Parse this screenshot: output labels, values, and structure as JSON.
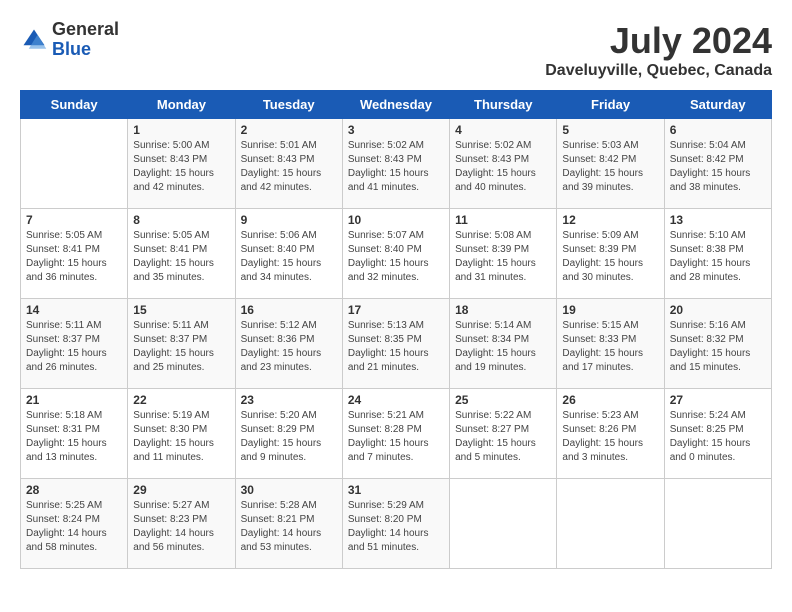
{
  "logo": {
    "general": "General",
    "blue": "Blue"
  },
  "title": {
    "month_year": "July 2024",
    "location": "Daveluyville, Quebec, Canada"
  },
  "headers": [
    "Sunday",
    "Monday",
    "Tuesday",
    "Wednesday",
    "Thursday",
    "Friday",
    "Saturday"
  ],
  "weeks": [
    [
      {
        "day": "",
        "sunrise": "",
        "sunset": "",
        "daylight": ""
      },
      {
        "day": "1",
        "sunrise": "Sunrise: 5:00 AM",
        "sunset": "Sunset: 8:43 PM",
        "daylight": "Daylight: 15 hours and 42 minutes."
      },
      {
        "day": "2",
        "sunrise": "Sunrise: 5:01 AM",
        "sunset": "Sunset: 8:43 PM",
        "daylight": "Daylight: 15 hours and 42 minutes."
      },
      {
        "day": "3",
        "sunrise": "Sunrise: 5:02 AM",
        "sunset": "Sunset: 8:43 PM",
        "daylight": "Daylight: 15 hours and 41 minutes."
      },
      {
        "day": "4",
        "sunrise": "Sunrise: 5:02 AM",
        "sunset": "Sunset: 8:43 PM",
        "daylight": "Daylight: 15 hours and 40 minutes."
      },
      {
        "day": "5",
        "sunrise": "Sunrise: 5:03 AM",
        "sunset": "Sunset: 8:42 PM",
        "daylight": "Daylight: 15 hours and 39 minutes."
      },
      {
        "day": "6",
        "sunrise": "Sunrise: 5:04 AM",
        "sunset": "Sunset: 8:42 PM",
        "daylight": "Daylight: 15 hours and 38 minutes."
      }
    ],
    [
      {
        "day": "7",
        "sunrise": "Sunrise: 5:05 AM",
        "sunset": "Sunset: 8:41 PM",
        "daylight": "Daylight: 15 hours and 36 minutes."
      },
      {
        "day": "8",
        "sunrise": "Sunrise: 5:05 AM",
        "sunset": "Sunset: 8:41 PM",
        "daylight": "Daylight: 15 hours and 35 minutes."
      },
      {
        "day": "9",
        "sunrise": "Sunrise: 5:06 AM",
        "sunset": "Sunset: 8:40 PM",
        "daylight": "Daylight: 15 hours and 34 minutes."
      },
      {
        "day": "10",
        "sunrise": "Sunrise: 5:07 AM",
        "sunset": "Sunset: 8:40 PM",
        "daylight": "Daylight: 15 hours and 32 minutes."
      },
      {
        "day": "11",
        "sunrise": "Sunrise: 5:08 AM",
        "sunset": "Sunset: 8:39 PM",
        "daylight": "Daylight: 15 hours and 31 minutes."
      },
      {
        "day": "12",
        "sunrise": "Sunrise: 5:09 AM",
        "sunset": "Sunset: 8:39 PM",
        "daylight": "Daylight: 15 hours and 30 minutes."
      },
      {
        "day": "13",
        "sunrise": "Sunrise: 5:10 AM",
        "sunset": "Sunset: 8:38 PM",
        "daylight": "Daylight: 15 hours and 28 minutes."
      }
    ],
    [
      {
        "day": "14",
        "sunrise": "Sunrise: 5:11 AM",
        "sunset": "Sunset: 8:37 PM",
        "daylight": "Daylight: 15 hours and 26 minutes."
      },
      {
        "day": "15",
        "sunrise": "Sunrise: 5:11 AM",
        "sunset": "Sunset: 8:37 PM",
        "daylight": "Daylight: 15 hours and 25 minutes."
      },
      {
        "day": "16",
        "sunrise": "Sunrise: 5:12 AM",
        "sunset": "Sunset: 8:36 PM",
        "daylight": "Daylight: 15 hours and 23 minutes."
      },
      {
        "day": "17",
        "sunrise": "Sunrise: 5:13 AM",
        "sunset": "Sunset: 8:35 PM",
        "daylight": "Daylight: 15 hours and 21 minutes."
      },
      {
        "day": "18",
        "sunrise": "Sunrise: 5:14 AM",
        "sunset": "Sunset: 8:34 PM",
        "daylight": "Daylight: 15 hours and 19 minutes."
      },
      {
        "day": "19",
        "sunrise": "Sunrise: 5:15 AM",
        "sunset": "Sunset: 8:33 PM",
        "daylight": "Daylight: 15 hours and 17 minutes."
      },
      {
        "day": "20",
        "sunrise": "Sunrise: 5:16 AM",
        "sunset": "Sunset: 8:32 PM",
        "daylight": "Daylight: 15 hours and 15 minutes."
      }
    ],
    [
      {
        "day": "21",
        "sunrise": "Sunrise: 5:18 AM",
        "sunset": "Sunset: 8:31 PM",
        "daylight": "Daylight: 15 hours and 13 minutes."
      },
      {
        "day": "22",
        "sunrise": "Sunrise: 5:19 AM",
        "sunset": "Sunset: 8:30 PM",
        "daylight": "Daylight: 15 hours and 11 minutes."
      },
      {
        "day": "23",
        "sunrise": "Sunrise: 5:20 AM",
        "sunset": "Sunset: 8:29 PM",
        "daylight": "Daylight: 15 hours and 9 minutes."
      },
      {
        "day": "24",
        "sunrise": "Sunrise: 5:21 AM",
        "sunset": "Sunset: 8:28 PM",
        "daylight": "Daylight: 15 hours and 7 minutes."
      },
      {
        "day": "25",
        "sunrise": "Sunrise: 5:22 AM",
        "sunset": "Sunset: 8:27 PM",
        "daylight": "Daylight: 15 hours and 5 minutes."
      },
      {
        "day": "26",
        "sunrise": "Sunrise: 5:23 AM",
        "sunset": "Sunset: 8:26 PM",
        "daylight": "Daylight: 15 hours and 3 minutes."
      },
      {
        "day": "27",
        "sunrise": "Sunrise: 5:24 AM",
        "sunset": "Sunset: 8:25 PM",
        "daylight": "Daylight: 15 hours and 0 minutes."
      }
    ],
    [
      {
        "day": "28",
        "sunrise": "Sunrise: 5:25 AM",
        "sunset": "Sunset: 8:24 PM",
        "daylight": "Daylight: 14 hours and 58 minutes."
      },
      {
        "day": "29",
        "sunrise": "Sunrise: 5:27 AM",
        "sunset": "Sunset: 8:23 PM",
        "daylight": "Daylight: 14 hours and 56 minutes."
      },
      {
        "day": "30",
        "sunrise": "Sunrise: 5:28 AM",
        "sunset": "Sunset: 8:21 PM",
        "daylight": "Daylight: 14 hours and 53 minutes."
      },
      {
        "day": "31",
        "sunrise": "Sunrise: 5:29 AM",
        "sunset": "Sunset: 8:20 PM",
        "daylight": "Daylight: 14 hours and 51 minutes."
      },
      {
        "day": "",
        "sunrise": "",
        "sunset": "",
        "daylight": ""
      },
      {
        "day": "",
        "sunrise": "",
        "sunset": "",
        "daylight": ""
      },
      {
        "day": "",
        "sunrise": "",
        "sunset": "",
        "daylight": ""
      }
    ]
  ]
}
